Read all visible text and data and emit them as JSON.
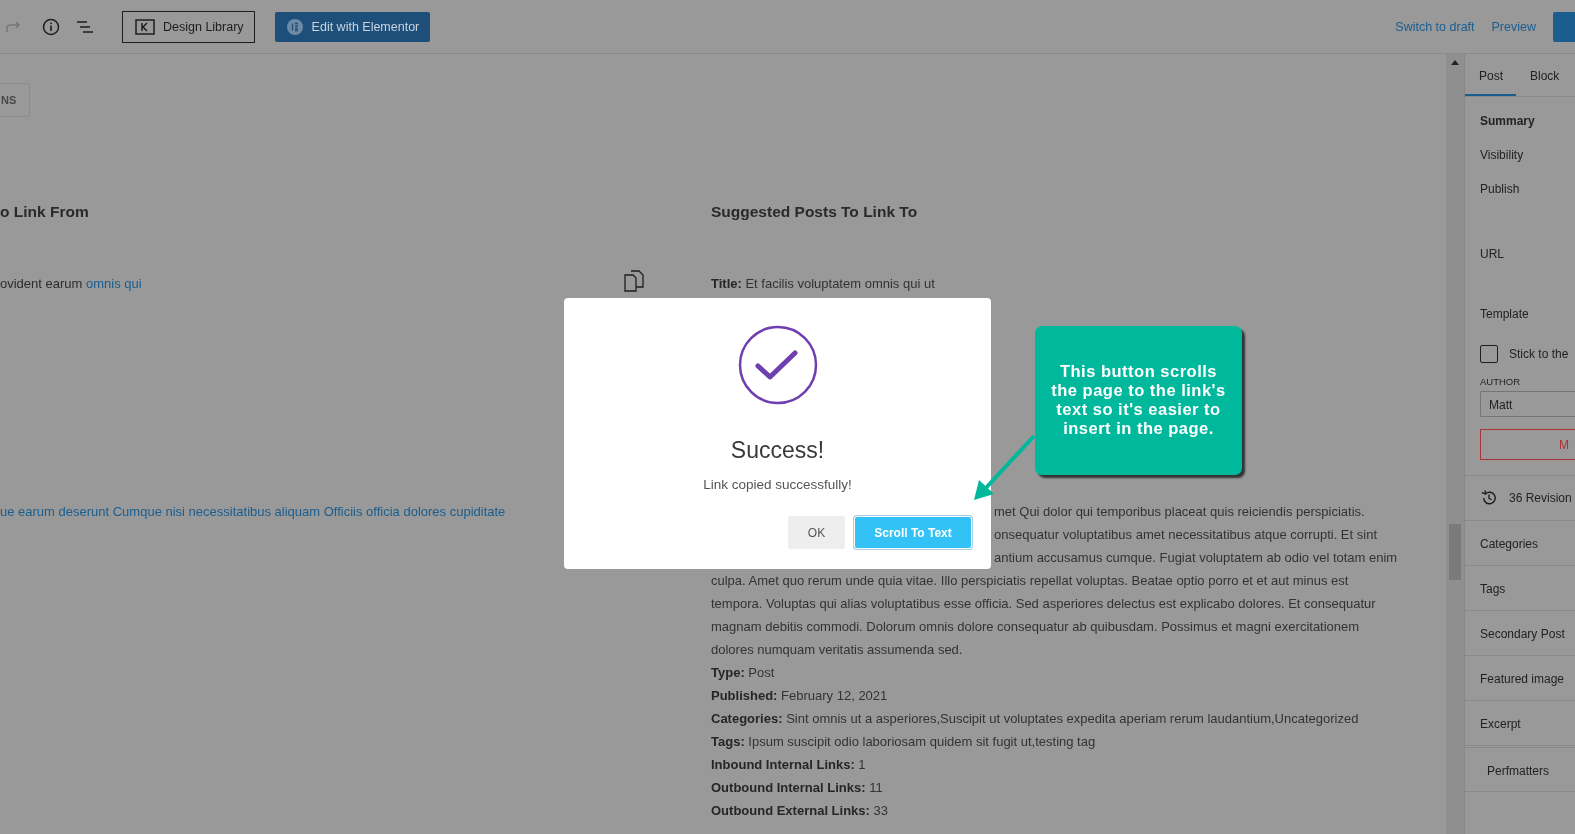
{
  "toolbar": {
    "design_library": "Design Library",
    "elementor": "Edit with Elementor",
    "switch_to_draft": "Switch to draft",
    "preview": "Preview"
  },
  "options_button": "NS",
  "left": {
    "heading": "o Link From",
    "rows": [
      {
        "text": "ovident earum",
        "link": "omnis qui"
      },
      {
        "link": "ue earum deserunt Cumque nisi necessitatibus aliquam Officiis officia dolores cupiditate"
      }
    ]
  },
  "right": {
    "heading": "Suggested Posts To Link To",
    "title": {
      "label": "Title:",
      "value": "Et facilis voluptatem omnis qui ut"
    },
    "description_lines": [
      "met Qui dolor qui temporibus placeat quis reiciendis perspiciatis.",
      "onsequatur voluptatibus amet necessitatibus atque corrupti. Et sint",
      "antium accusamus cumque. Fugiat voluptatem ab odio vel totam enim",
      "culpa. Amet quo rerum unde quia vitae. Illo perspiciatis repellat voluptas. Beatae optio porro et et aut minus est",
      "tempora. Voluptas qui alias voluptatibus esse officia. Sed asperiores delectus est explicabo dolores. Et consequatur",
      "magnam debitis commodi. Dolorum omnis dolore consequatur ab quibusdam. Possimus et magni exercitationem",
      "dolores numquam veritatis assumenda sed."
    ],
    "fields": [
      {
        "label": "Type:",
        "value": "Post"
      },
      {
        "label": "Published:",
        "value": "February 12, 2021"
      },
      {
        "label": "Categories:",
        "value": "Sint omnis ut a asperiores,Suscipit ut voluptates expedita aperiam rerum laudantium,Uncategorized"
      },
      {
        "label": "Tags:",
        "value": "Ipsum suscipit odio laboriosam quidem sit fugit ut,testing tag"
      },
      {
        "label": "Inbound Internal Links:",
        "value": "1"
      },
      {
        "label": "Outbound Internal Links:",
        "value": "11"
      },
      {
        "label": "Outbound External Links:",
        "value": "33"
      }
    ]
  },
  "modal": {
    "title": "Success!",
    "message": "Link copied successfully!",
    "buttons": [
      {
        "label": "OK",
        "kind": "secondary"
      },
      {
        "label": "Scroll To Text",
        "kind": "primary"
      }
    ]
  },
  "callout": {
    "text": "This button scrolls the page to the link's text so it's easier to insert in the page."
  },
  "sidebar": {
    "tabs": [
      {
        "label": "Post",
        "selected": true
      },
      {
        "label": "Block",
        "selected": false
      }
    ],
    "summary": {
      "heading": "Summary",
      "rows": [
        "Visibility",
        "Publish",
        "URL",
        "Template"
      ]
    },
    "sticky": {
      "label": "Stick to the",
      "checked": false
    },
    "author": {
      "label": "AUTHOR",
      "value": "Matt"
    },
    "trash_button": "M",
    "revisions": "36 Revision",
    "panels": [
      "Categories",
      "Tags",
      "Secondary Post",
      "Featured image",
      "Excerpt",
      "Perfmatters"
    ]
  }
}
